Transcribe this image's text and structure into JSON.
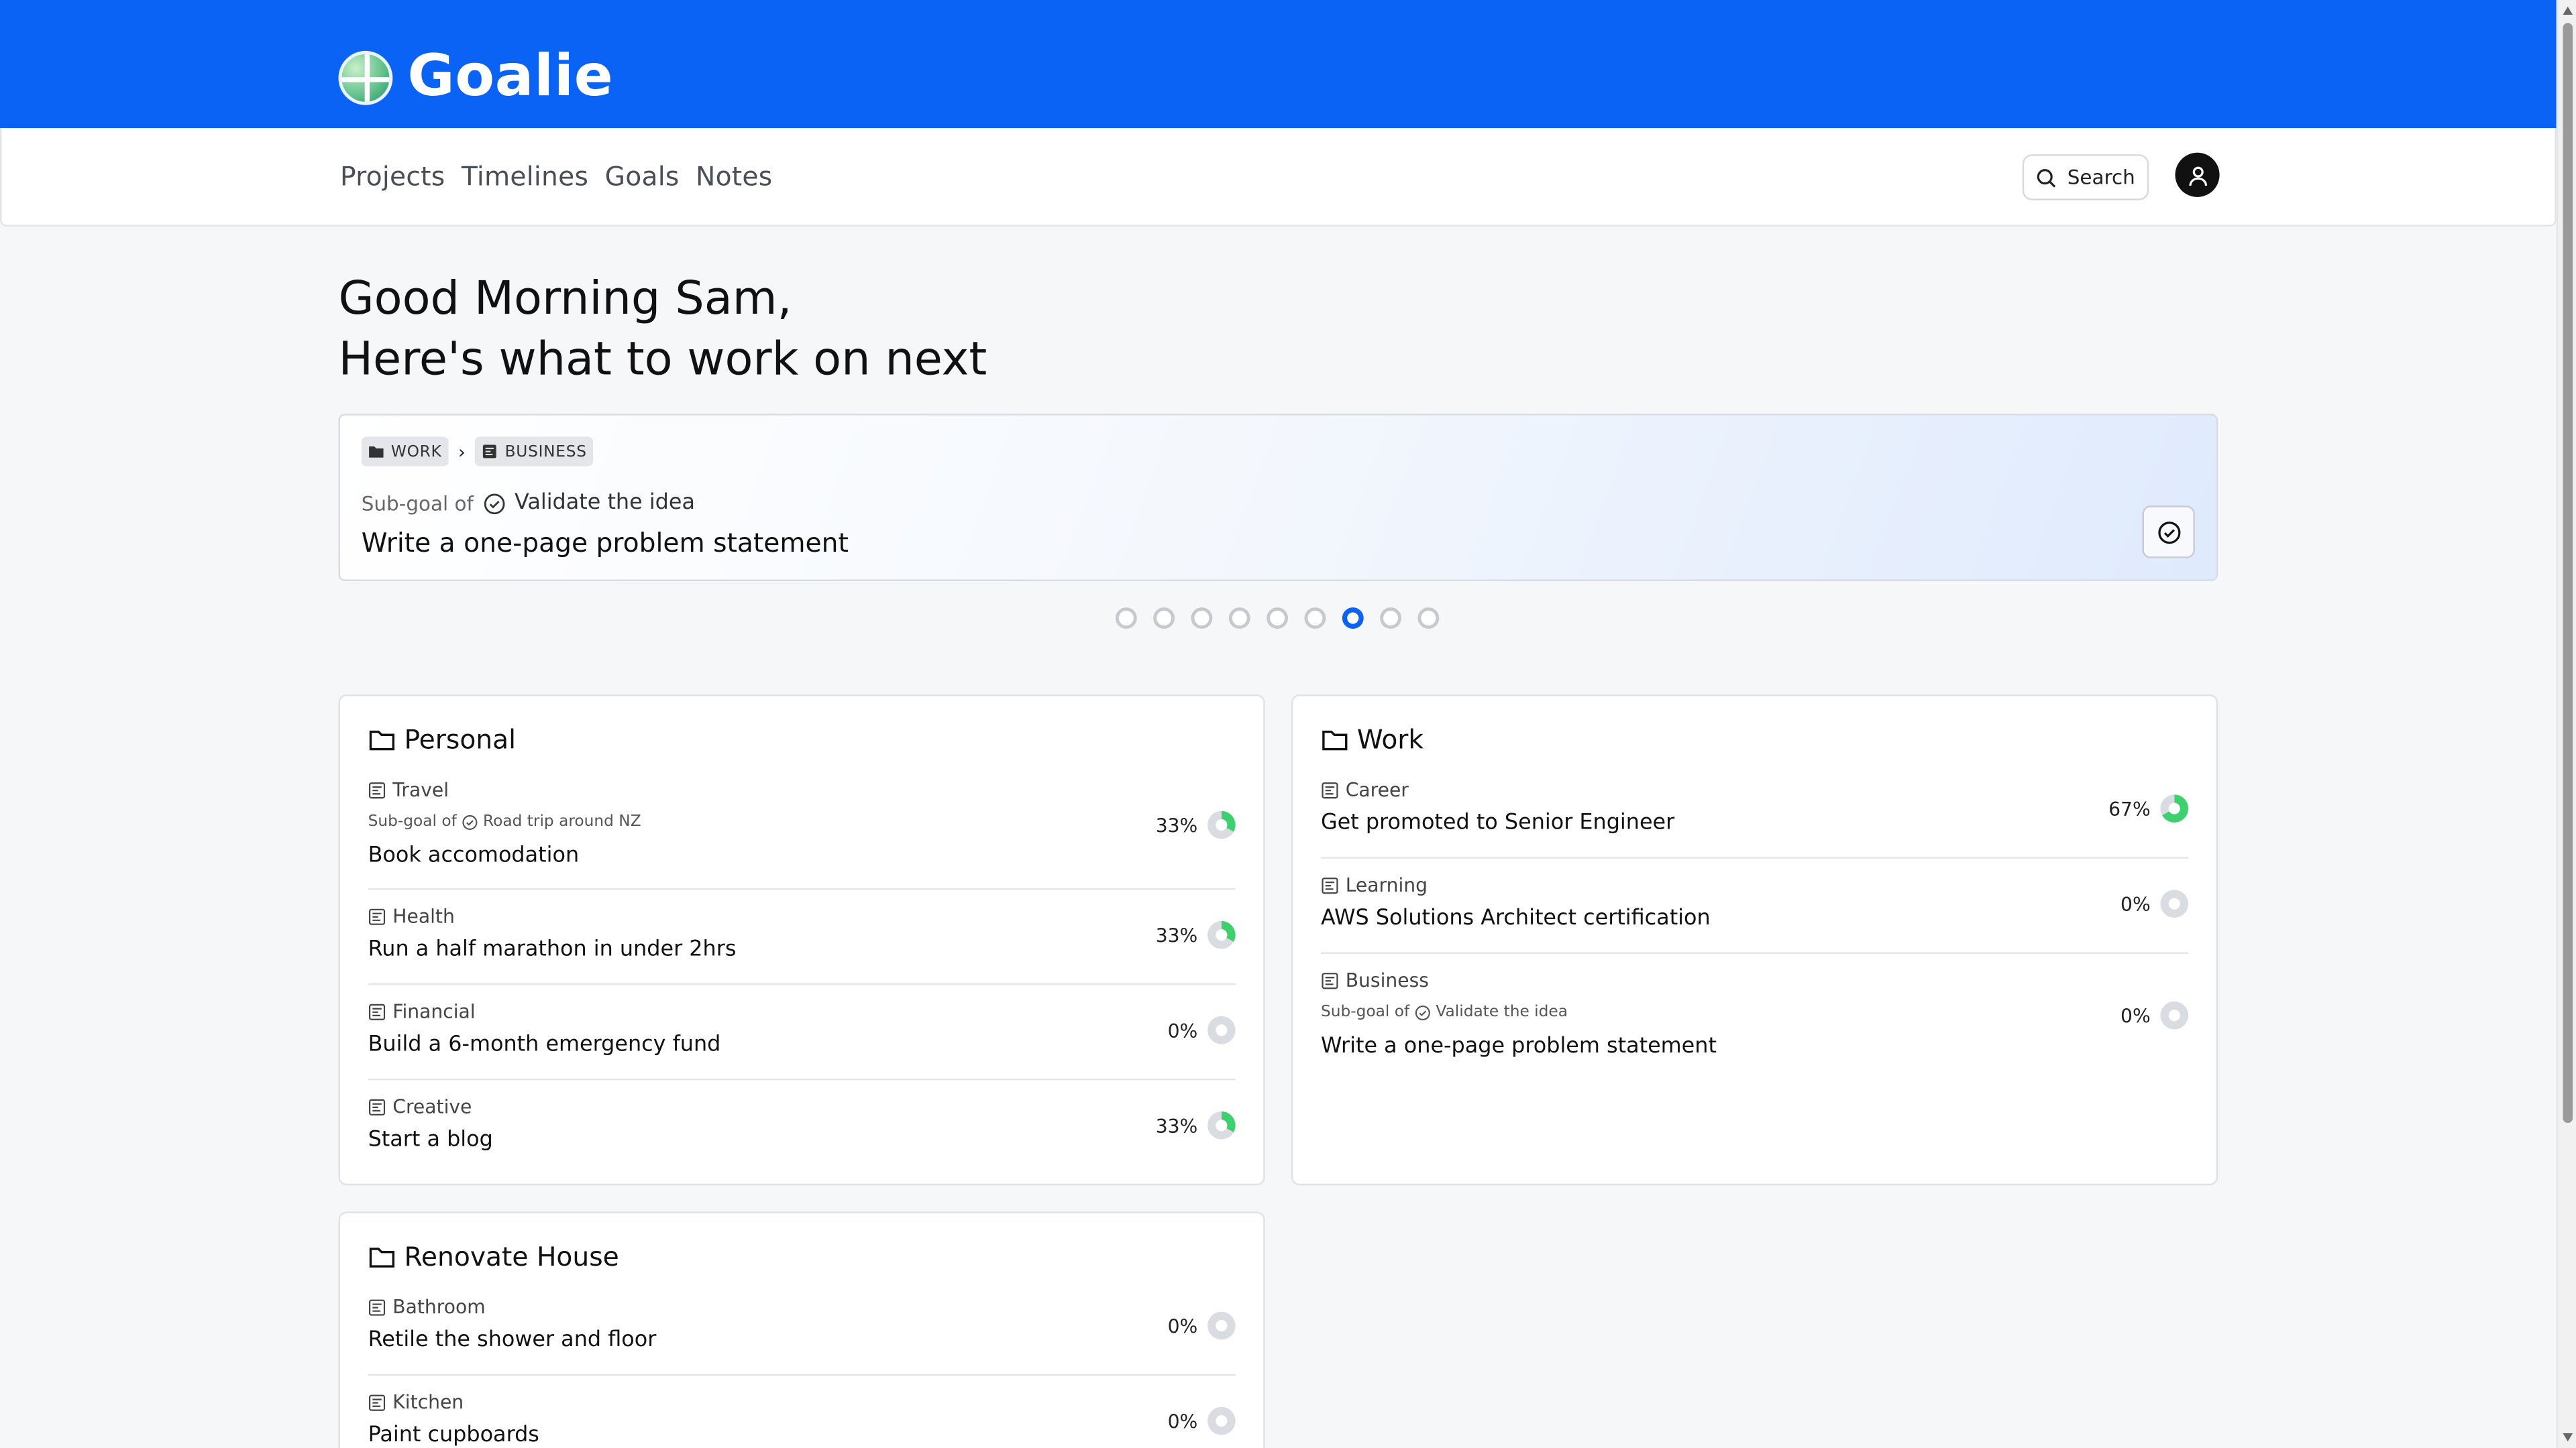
{
  "app": {
    "name": "Goalie"
  },
  "nav": {
    "links": [
      "Projects",
      "Timelines",
      "Goals",
      "Notes"
    ],
    "search_label": "Search"
  },
  "greeting": {
    "line1": "Good Morning Sam,",
    "line2": "Here's what to work on next"
  },
  "hero": {
    "breadcrumb": [
      "WORK",
      "BUSINESS"
    ],
    "sub_prefix": "Sub-goal of",
    "parent_goal": "Validate the idea",
    "title": "Write a one-page problem statement",
    "pager": {
      "total": 9,
      "active_index": 6
    }
  },
  "panels": {
    "personal": {
      "title": "Personal",
      "goals": [
        {
          "category": "Travel",
          "sub_prefix": "Sub-goal of",
          "parent": "Road trip around NZ",
          "title": "Book accomodation",
          "progress": "33%",
          "progress_fraction": 0.33
        },
        {
          "category": "Health",
          "title": "Run a half marathon in under 2hrs",
          "progress": "33%",
          "progress_fraction": 0.33
        },
        {
          "category": "Financial",
          "title": "Build a 6-month emergency fund",
          "progress": "0%",
          "progress_fraction": 0
        },
        {
          "category": "Creative",
          "title": "Start a blog",
          "progress": "33%",
          "progress_fraction": 0.33
        }
      ]
    },
    "work": {
      "title": "Work",
      "goals": [
        {
          "category": "Career",
          "title": "Get promoted to Senior Engineer",
          "progress": "67%",
          "progress_fraction": 0.67
        },
        {
          "category": "Learning",
          "title": "AWS Solutions Architect certification",
          "progress": "0%",
          "progress_fraction": 0
        },
        {
          "category": "Business",
          "sub_prefix": "Sub-goal of",
          "parent": "Validate the idea",
          "title": "Write a one-page problem statement",
          "progress": "0%",
          "progress_fraction": 0
        }
      ]
    },
    "renovate": {
      "title": "Renovate House",
      "goals": [
        {
          "category": "Bathroom",
          "title": "Retile the shower and floor",
          "progress": "0%",
          "progress_fraction": 0
        },
        {
          "category": "Kitchen",
          "title": "Paint cupboards",
          "progress": "0%",
          "progress_fraction": 0
        }
      ]
    }
  },
  "colors": {
    "brand": "#0b63f6",
    "progress_fill": "#3ecf6e",
    "progress_track": "#d9dce1",
    "active_dot": "#0b63f6"
  },
  "icons": {
    "folder": "folder-icon",
    "goal_category": "goal-category-icon",
    "check_circle": "check-circle-icon",
    "search": "search-icon",
    "user": "user-icon"
  }
}
